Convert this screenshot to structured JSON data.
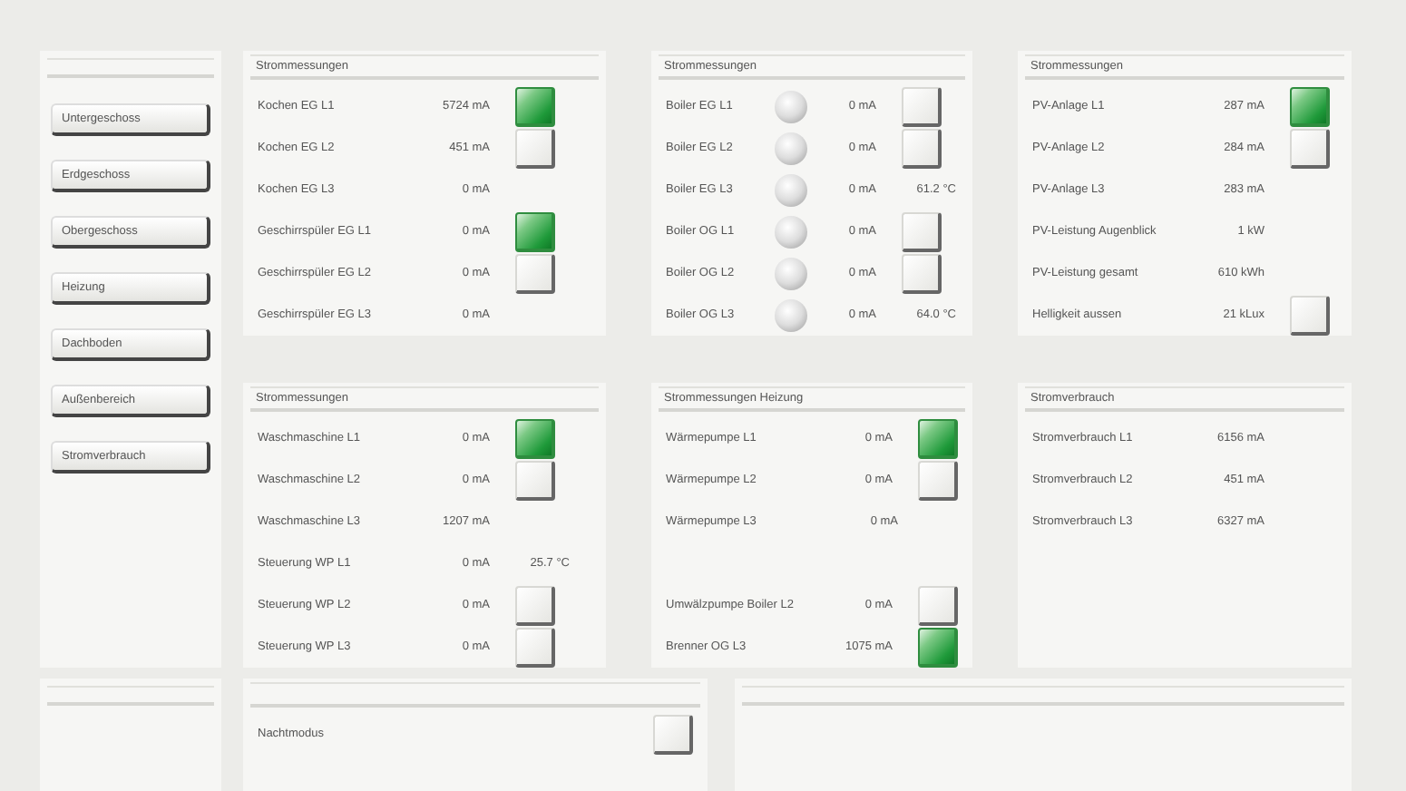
{
  "navigation": [
    {
      "label": "Untergeschoss"
    },
    {
      "label": "Erdgeschoss"
    },
    {
      "label": "Obergeschoss"
    },
    {
      "label": "Heizung"
    },
    {
      "label": "Dachboden"
    },
    {
      "label": "Außenbereich"
    },
    {
      "label": "Stromverbrauch"
    }
  ],
  "panels": [
    {
      "title": "Strommessungen",
      "lamps": false,
      "rows": [
        {
          "label": "Kochen EG L1",
          "value": "5724 mA",
          "kind": "toggle",
          "on": true
        },
        {
          "label": "Kochen EG L2",
          "value": "451 mA",
          "kind": "toggle",
          "on": false
        },
        {
          "label": "Kochen EG L3",
          "value": "0 mA",
          "kind": "plain"
        },
        {
          "label": "Geschirrspüler EG L1",
          "value": "0 mA",
          "kind": "toggle",
          "on": true
        },
        {
          "label": "Geschirrspüler EG L2",
          "value": "0 mA",
          "kind": "toggle",
          "on": false
        },
        {
          "label": "Geschirrspüler EG L3",
          "value": "0 mA",
          "kind": "plain"
        }
      ]
    },
    {
      "title": "Strommessungen",
      "lamps": true,
      "rows": [
        {
          "label": "Boiler EG L1",
          "value": "0 mA",
          "kind": "toggle",
          "on": false
        },
        {
          "label": "Boiler EG L2",
          "value": "0 mA",
          "kind": "toggle",
          "on": false
        },
        {
          "label": "Boiler EG L3",
          "value": "0 mA",
          "kind": "temperature",
          "reading": "61.2 °C"
        },
        {
          "label": "Boiler OG L1",
          "value": "0 mA",
          "kind": "toggle",
          "on": false
        },
        {
          "label": "Boiler OG L2",
          "value": "0 mA",
          "kind": "toggle",
          "on": false
        },
        {
          "label": "Boiler OG L3",
          "value": "0 mA",
          "kind": "temperature",
          "reading": "64.0 °C"
        }
      ]
    },
    {
      "title": "Strommessungen",
      "lamps": false,
      "rows": [
        {
          "label": "PV-Anlage L1",
          "value": "287 mA",
          "kind": "toggle",
          "on": true
        },
        {
          "label": "PV-Anlage L2",
          "value": "284 mA",
          "kind": "toggle",
          "on": false
        },
        {
          "label": "PV-Anlage L3",
          "value": "283 mA",
          "kind": "plain"
        },
        {
          "label": "PV-Leistung Augenblick",
          "value": "1 kW",
          "kind": "plain"
        },
        {
          "label": "PV-Leistung gesamt",
          "value": "610 kWh",
          "kind": "plain"
        },
        {
          "label": "Helligkeit aussen",
          "value": "21 kLux",
          "kind": "toggle",
          "on": false
        }
      ]
    },
    {
      "title": "Strommessungen",
      "lamps": false,
      "rows": [
        {
          "label": "Waschmaschine L1",
          "value": "0 mA",
          "kind": "toggle",
          "on": true
        },
        {
          "label": "Waschmaschine L2",
          "value": "0 mA",
          "kind": "toggle",
          "on": false
        },
        {
          "label": "Waschmaschine L3",
          "value": "1207 mA",
          "kind": "plain"
        },
        {
          "label": "Steuerung WP L1",
          "value": "0 mA",
          "kind": "temperature",
          "reading": "25.7 °C"
        },
        {
          "label": "Steuerung WP L2",
          "value": "0 mA",
          "kind": "toggle",
          "on": false
        },
        {
          "label": "Steuerung WP L3",
          "value": "0 mA",
          "kind": "toggle",
          "on": false
        }
      ]
    },
    {
      "title": "Strommessungen Heizung",
      "lamps": false,
      "rows": [
        {
          "label": "Wärmepumpe L1",
          "value": "0 mA",
          "kind": "toggle",
          "on": true
        },
        {
          "label": "Wärmepumpe L2",
          "value": "0 mA",
          "kind": "toggle",
          "on": false
        },
        {
          "label": "Wärmepumpe L3",
          "value": "0 mA",
          "kind": "plain"
        },
        {
          "kind": "spacer"
        },
        {
          "label": "Umwälzpumpe Boiler L2",
          "value": "0 mA",
          "kind": "toggle",
          "on": false
        },
        {
          "label": "Brenner OG L3",
          "value": "1075 mA",
          "kind": "toggle",
          "on": true
        }
      ]
    },
    {
      "title": "Stromverbrauch",
      "lamps": false,
      "rows": [
        {
          "label": "Stromverbrauch L1",
          "value": "6156 mA",
          "kind": "plain"
        },
        {
          "label": "Stromverbrauch L2",
          "value": "451 mA",
          "kind": "plain"
        },
        {
          "label": "Stromverbrauch L3",
          "value": "6327 mA",
          "kind": "plain"
        }
      ]
    }
  ],
  "bottom_panel": {
    "rows": [
      {
        "label": "Nachtmodus",
        "kind": "toggle",
        "on": false
      }
    ]
  }
}
